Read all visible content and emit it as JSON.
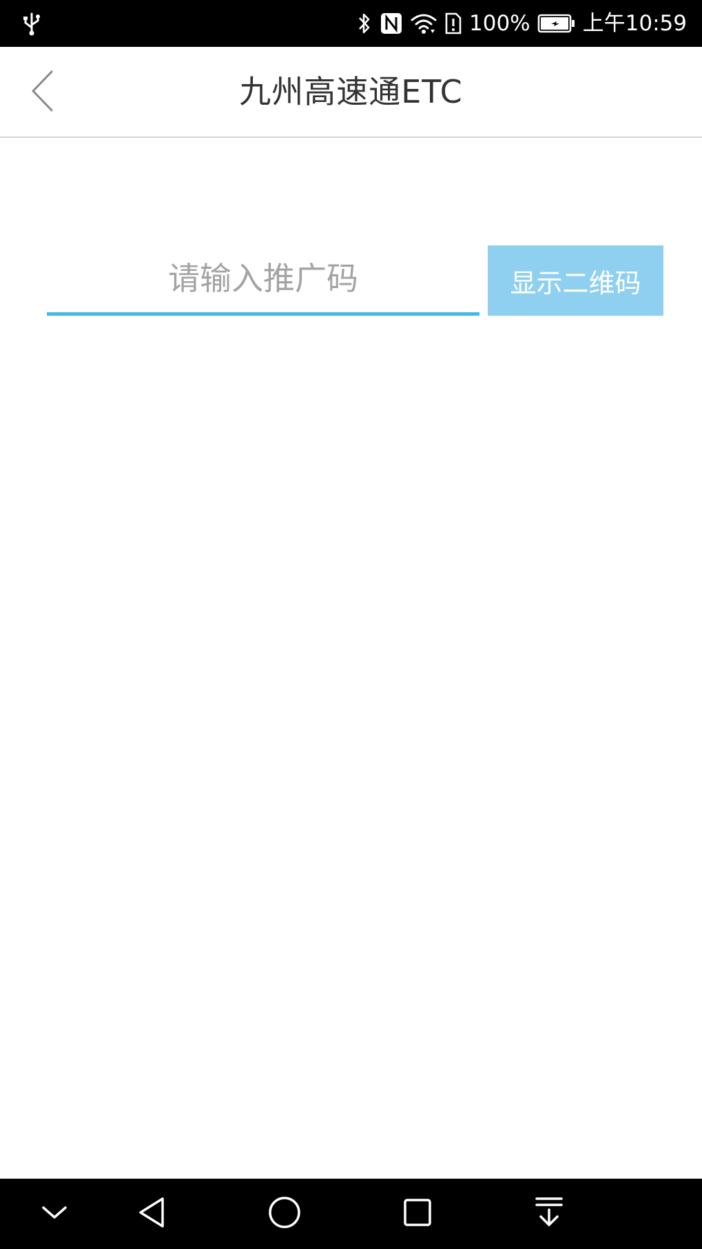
{
  "status_bar": {
    "battery": "100%",
    "time": "上午10:59",
    "icons": [
      "usb-icon",
      "bluetooth-icon",
      "nfc-icon",
      "wifi-icon",
      "sim-alert-icon",
      "battery-charging-icon"
    ]
  },
  "header": {
    "title": "九州高速通ETC",
    "back_icon": "chevron-left-icon"
  },
  "promo": {
    "input_value": "",
    "input_placeholder": "请输入推广码",
    "button_label": "显示二维码"
  },
  "nav_bar": {
    "icons": [
      "chevron-down-icon",
      "back-triangle-icon",
      "home-circle-icon",
      "recents-square-icon",
      "notification-pull-icon"
    ]
  },
  "colors": {
    "accent": "#3eb9e8",
    "button_bg": "#8fd0f0",
    "title_text": "#333333",
    "placeholder": "#a3a3a3"
  }
}
